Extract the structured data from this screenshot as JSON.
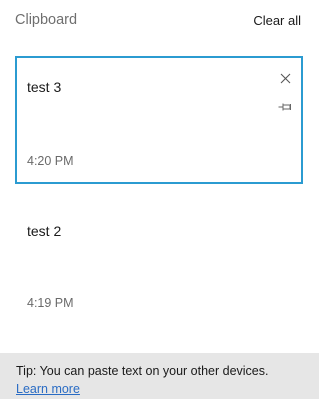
{
  "header": {
    "title": "Clipboard",
    "clear_all_label": "Clear all"
  },
  "items": [
    {
      "text": "test 3",
      "time": "4:20 PM",
      "selected": true,
      "icons": [
        "close-icon",
        "pin-icon"
      ]
    },
    {
      "text": "test 2",
      "time": "4:19 PM",
      "selected": false
    }
  ],
  "footer": {
    "tip": "Tip: You can paste text on your other devices.",
    "link_label": "Learn more"
  },
  "colors": {
    "accent_border": "#2b9bd1",
    "link": "#2a6cc4",
    "footer_bg": "#e6e6e6"
  }
}
